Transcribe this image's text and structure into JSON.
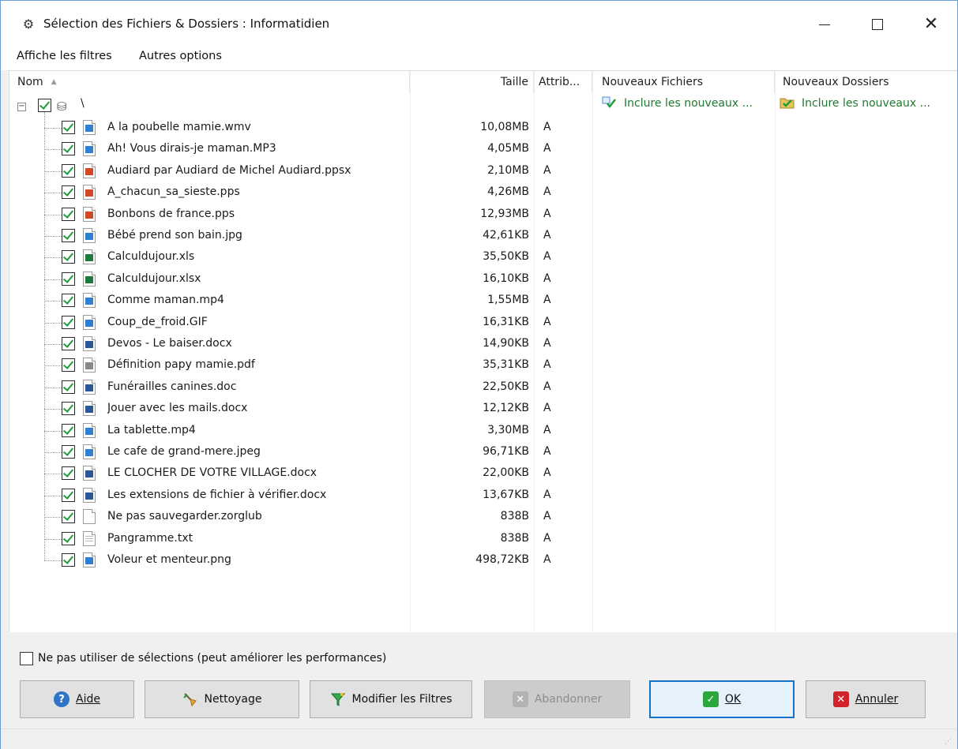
{
  "window": {
    "title": "Sélection des Fichiers & Dossiers : Informatidien",
    "app_icon": "gear-icon",
    "controls": [
      "minimize-icon",
      "maximize-icon",
      "close-icon"
    ]
  },
  "menu": {
    "items": [
      "Affiche les filtres",
      "Autres options"
    ]
  },
  "tree": {
    "columns": {
      "name": "Nom",
      "size": "Taille",
      "attrib": "Attrib...",
      "new_files": "Nouveaux Fichiers",
      "new_folders": "Nouveaux Dossiers"
    },
    "root": {
      "label": "\\",
      "checked": true,
      "new_files_text": "Inclure les nouveaux ...",
      "new_folders_text": "Inclure les nouveaux ..."
    },
    "files": [
      {
        "name": "A la poubelle mamie.wmv",
        "size": "10,08MB",
        "attrib": "A",
        "icon": "video-icon"
      },
      {
        "name": "Ah! Vous dirais-je maman.MP3",
        "size": "4,05MB",
        "attrib": "A",
        "icon": "audio-icon"
      },
      {
        "name": "Audiard par Audiard de Michel Audiard.ppsx",
        "size": "2,10MB",
        "attrib": "A",
        "icon": "powerpoint-icon"
      },
      {
        "name": "A_chacun_sa_sieste.pps",
        "size": "4,26MB",
        "attrib": "A",
        "icon": "powerpoint-icon"
      },
      {
        "name": "Bonbons de france.pps",
        "size": "12,93MB",
        "attrib": "A",
        "icon": "powerpoint-icon"
      },
      {
        "name": "Bébé prend son bain.jpg",
        "size": "42,61KB",
        "attrib": "A",
        "icon": "image-icon"
      },
      {
        "name": "Calculdujour.xls",
        "size": "35,50KB",
        "attrib": "A",
        "icon": "excel-icon"
      },
      {
        "name": "Calculdujour.xlsx",
        "size": "16,10KB",
        "attrib": "A",
        "icon": "excel-icon"
      },
      {
        "name": "Comme maman.mp4",
        "size": "1,55MB",
        "attrib": "A",
        "icon": "video-icon"
      },
      {
        "name": "Coup_de_froid.GIF",
        "size": "16,31KB",
        "attrib": "A",
        "icon": "image-icon"
      },
      {
        "name": "Devos - Le baiser.docx",
        "size": "14,90KB",
        "attrib": "A",
        "icon": "word-icon"
      },
      {
        "name": "Définition papy mamie.pdf",
        "size": "35,31KB",
        "attrib": "A",
        "icon": "pdf-icon"
      },
      {
        "name": "Funérailles canines.doc",
        "size": "22,50KB",
        "attrib": "A",
        "icon": "word-icon"
      },
      {
        "name": "Jouer avec les mails.docx",
        "size": "12,12KB",
        "attrib": "A",
        "icon": "word-icon"
      },
      {
        "name": "La tablette.mp4",
        "size": "3,30MB",
        "attrib": "A",
        "icon": "video-icon"
      },
      {
        "name": "Le cafe de grand-mere.jpeg",
        "size": "96,71KB",
        "attrib": "A",
        "icon": "image-icon"
      },
      {
        "name": "LE CLOCHER DE VOTRE VILLAGE.docx",
        "size": "22,00KB",
        "attrib": "A",
        "icon": "word-icon"
      },
      {
        "name": "Les extensions de fichier à vérifier.docx",
        "size": "13,67KB",
        "attrib": "A",
        "icon": "word-icon"
      },
      {
        "name": "Ne pas sauvegarder.zorglub",
        "size": "838B",
        "attrib": "A",
        "icon": "blank-file-icon"
      },
      {
        "name": "Pangramme.txt",
        "size": "838B",
        "attrib": "A",
        "icon": "text-file-icon"
      },
      {
        "name": "Voleur et menteur.png",
        "size": "498,72KB",
        "attrib": "A",
        "icon": "image-icon"
      }
    ]
  },
  "options": {
    "no_selection_label": "Ne pas utiliser de sélections (peut améliorer les performances)",
    "no_selection_checked": false
  },
  "buttons": {
    "help": "Aide",
    "clean": "Nettoyage",
    "filters": "Modifier les Filtres",
    "abort": "Abandonner",
    "ok": "OK",
    "cancel": "Annuler"
  },
  "colors": {
    "accent": "#1672c9",
    "check_green": "#1e9c3a",
    "include_green": "#1e7a2e",
    "cancel_red": "#d0242a"
  }
}
